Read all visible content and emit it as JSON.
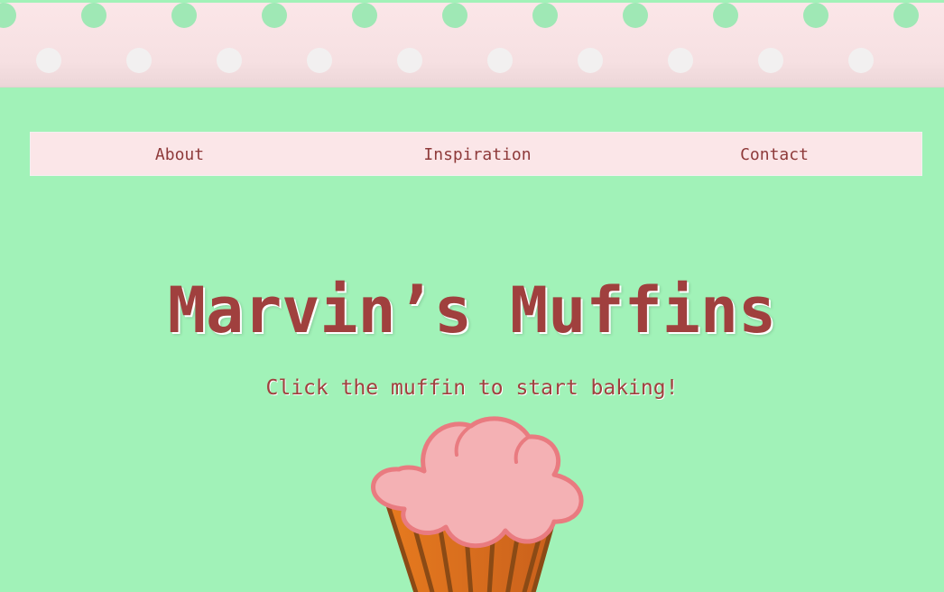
{
  "nav": {
    "items": [
      {
        "label": "About"
      },
      {
        "label": "Inspiration"
      },
      {
        "label": "Contact"
      }
    ]
  },
  "hero": {
    "title": "Marvin’s Muffins",
    "subtitle": "Click the muffin to start baking!"
  },
  "colors": {
    "background": "#a1f2b8",
    "banner": "#fbe6e8",
    "text": "#a0403e",
    "frosting": "#f4b1b4",
    "frosting_outline": "#e97b80",
    "wrapper": "#d4701e",
    "wrapper_outline": "#8b4a15"
  },
  "icons": {
    "muffin": "muffin-icon",
    "banner_pattern": "polka-dot-pattern"
  }
}
